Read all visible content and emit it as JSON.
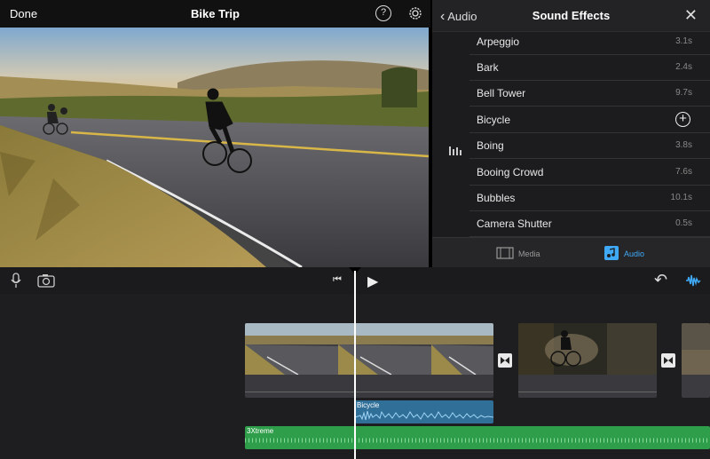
{
  "topbar": {
    "done_label": "Done",
    "title": "Bike Trip",
    "help_symbol": "?"
  },
  "panel": {
    "back_label": "Audio",
    "title": "Sound Effects",
    "close_symbol": "✕",
    "items": [
      {
        "name": "Arpeggio",
        "duration": "3.1s"
      },
      {
        "name": "Bark",
        "duration": "2.4s"
      },
      {
        "name": "Bell Tower",
        "duration": "9.7s"
      },
      {
        "name": "Bicycle",
        "duration": ""
      },
      {
        "name": "Boing",
        "duration": "3.8s"
      },
      {
        "name": "Booing Crowd",
        "duration": "7.6s"
      },
      {
        "name": "Bubbles",
        "duration": "10.1s"
      },
      {
        "name": "Camera Shutter",
        "duration": "0.5s"
      }
    ],
    "selected_item": "Bicycle",
    "tabs": {
      "media": "Media",
      "audio": "Audio"
    },
    "accent_color": "#3fa9f5"
  },
  "timeline": {
    "sfx_clip_label": "Bicycle",
    "music_clip_label": "3Xtreme",
    "sfx_color": "#2f6f98",
    "music_color": "#2e9e4a"
  },
  "icons": {
    "add": "+",
    "skip_back": "⏮",
    "play": "▶",
    "undo": "↶"
  }
}
